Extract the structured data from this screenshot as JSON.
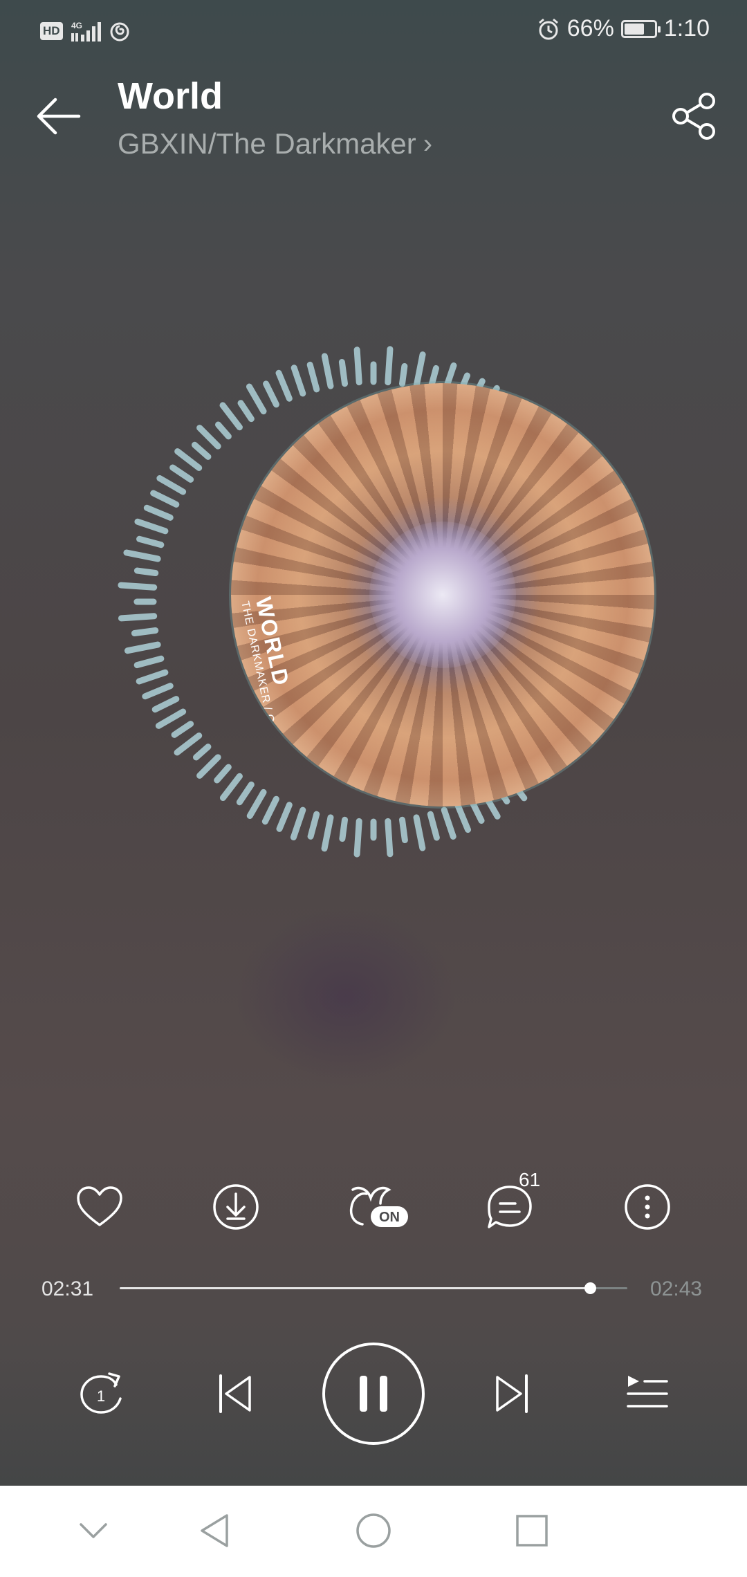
{
  "status_bar": {
    "hd_badge": "HD",
    "network": "4G",
    "battery_percent_text": "66%",
    "battery_level": 0.66,
    "time": "1:10",
    "icons": [
      "signal-icon",
      "netease-notification-icon",
      "alarm-icon",
      "battery-icon"
    ]
  },
  "header": {
    "title": "World",
    "artist": "GBXIN/The Darkmaker",
    "artist_chevron": "›"
  },
  "album": {
    "cover_title": "WORLD",
    "cover_subtitle": "THE DARKMAKER / GBXIN",
    "visualizer_color": "#a9c9d0"
  },
  "actions": {
    "icons": [
      "heart-icon",
      "download-icon",
      "sound-effect-on-icon",
      "comment-icon",
      "more-icon"
    ],
    "sound_effect_badge": "ON",
    "comment_count": "61"
  },
  "progress": {
    "current_time": "02:31",
    "total_time": "02:43",
    "fraction": 0.926
  },
  "playback": {
    "repeat_badge": "1",
    "icons": [
      "repeat-one-icon",
      "previous-icon",
      "pause-icon",
      "next-icon",
      "playlist-icon"
    ]
  },
  "nav_bar": {
    "icons": [
      "collapse-icon",
      "back-icon",
      "home-icon",
      "recents-icon"
    ]
  },
  "colors": {
    "accent": "#ffffff",
    "secondary_text": "#a9aeae",
    "nav_icon": "#9aa0a0"
  }
}
